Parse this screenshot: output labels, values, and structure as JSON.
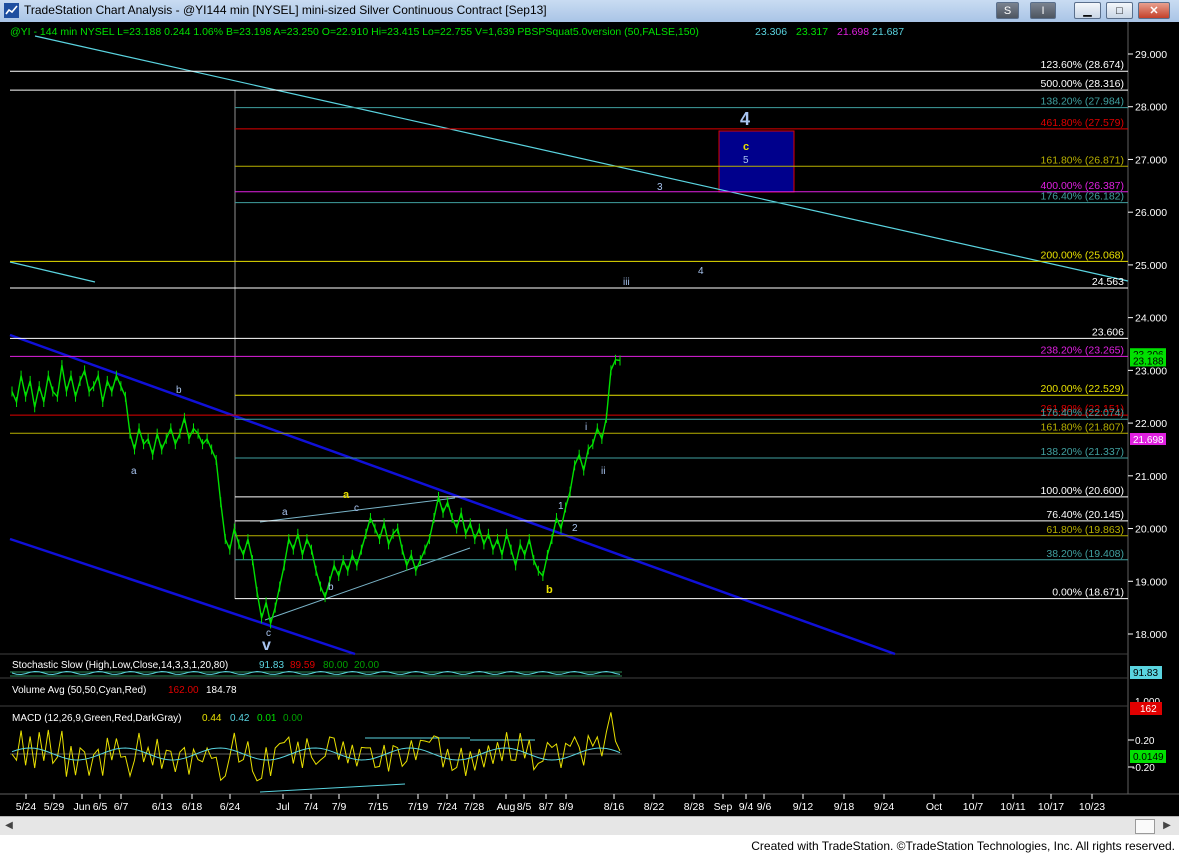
{
  "window": {
    "title": "TradeStation Chart Analysis - @YI144 min [NYSEL] mini-sized Silver Continuous Contract [Sep13]",
    "buttons": {
      "s": "S",
      "info": "I",
      "minimize": "▁",
      "maximize": "□",
      "close": "✕"
    }
  },
  "header": {
    "symbol_text": "@YI - 144 min  NYSEL  L=23.188  0.244  1.06%  B=23.198  A=23.250  O=22.910  Hi=23.415  Lo=22.755  V=1,639  PBSPSquat5.0version (50,FALSE,150)",
    "ind_values": [
      "23.306",
      "23.317",
      "21.698",
      "21.687"
    ]
  },
  "colors": {
    "green_price": "#00e000",
    "white": "#ffffff",
    "blue_channel": "#1010d8",
    "cyan_trend": "#5ad4e0",
    "red_fib": "#e00000",
    "magenta_fib": "#e020e0",
    "yellow_fib": "#e8e000",
    "olive_fib": "#b8b000",
    "teal_fib": "#40a0a0",
    "label_blue": "#a8c4f0",
    "box_fill": "#00008c"
  },
  "chart_data": {
    "type": "line",
    "title": "@YI 144 min mini-sized Silver Continuous Contract [Sep13]",
    "ylim": [
      17.5,
      29.4
    ],
    "price_axis_ticks": [
      "29.000",
      "28.000",
      "27.000",
      "26.000",
      "25.000",
      "24.000",
      "23.000",
      "22.000",
      "21.000",
      "20.000",
      "19.000",
      "18.000"
    ],
    "x_ticks": [
      "5/24",
      "5/29",
      "Jun",
      "6/5",
      "6/7",
      "6/13",
      "6/18",
      "6/24",
      "Jul",
      "7/4",
      "7/9",
      "7/15",
      "7/19",
      "7/24",
      "7/28",
      "Aug",
      "8/5",
      "8/7",
      "8/9",
      "8/16",
      "8/22",
      "8/28",
      "Sep",
      "9/4",
      "9/6",
      "9/12",
      "9/18",
      "9/24",
      "Oct",
      "10/7",
      "10/11",
      "10/17",
      "10/23"
    ],
    "series": [
      {
        "name": "price",
        "values": [
          22.6,
          22.4,
          22.9,
          22.5,
          22.8,
          22.3,
          22.7,
          22.4,
          22.9,
          22.6,
          22.5,
          23.1,
          22.6,
          22.9,
          22.5,
          22.8,
          23.0,
          22.6,
          22.7,
          22.9,
          22.4,
          22.8,
          22.6,
          22.9,
          22.7,
          22.5,
          21.8,
          21.5,
          21.9,
          21.6,
          21.7,
          21.4,
          21.8,
          21.5,
          21.7,
          21.9,
          21.6,
          21.8,
          22.1,
          21.7,
          21.9,
          21.8,
          21.6,
          21.7,
          21.5,
          21.3,
          20.5,
          19.8,
          19.6,
          20.0,
          19.7,
          19.5,
          19.8,
          19.4,
          18.8,
          18.3,
          18.6,
          18.2,
          18.5,
          18.9,
          19.3,
          19.8,
          19.6,
          19.9,
          19.5,
          19.8,
          19.6,
          19.2,
          18.9,
          18.7,
          19.0,
          19.3,
          19.1,
          19.4,
          19.2,
          19.5,
          19.3,
          19.6,
          19.9,
          20.2,
          20.0,
          19.8,
          20.1,
          19.7,
          19.9,
          20.0,
          19.6,
          19.3,
          19.5,
          19.2,
          19.4,
          19.6,
          19.8,
          20.2,
          20.6,
          20.3,
          20.5,
          20.2,
          20.0,
          20.3,
          19.9,
          20.1,
          19.8,
          20.0,
          19.7,
          19.9,
          19.6,
          19.8,
          19.5,
          19.9,
          19.6,
          19.3,
          19.7,
          19.5,
          19.8,
          19.4,
          19.2,
          19.1,
          19.5,
          19.8,
          20.2,
          20.0,
          20.4,
          20.7,
          21.2,
          21.4,
          21.1,
          21.5,
          21.6,
          21.9,
          21.7,
          22.1,
          23.0,
          23.2,
          23.188
        ]
      },
      {
        "name": "Stochastic Slow",
        "values": [
          91.83,
          89.59
        ]
      },
      {
        "name": "MACD",
        "values": [
          0.44,
          0.42,
          0.01
        ]
      }
    ],
    "fib_levels": [
      {
        "label": "123.60% (28.674)",
        "value": 28.674,
        "color": "white"
      },
      {
        "label": "500.00% (28.316)",
        "value": 28.316,
        "color": "white"
      },
      {
        "label": "138.20% (27.984)",
        "value": 27.984,
        "color": "teal_fib"
      },
      {
        "label": "461.80% (27.579)",
        "value": 27.579,
        "color": "red_fib"
      },
      {
        "label": "161.80% (26.871)",
        "value": 26.871,
        "color": "olive_fib"
      },
      {
        "label": "400.00% (26.387)",
        "value": 26.387,
        "color": "magenta_fib"
      },
      {
        "label": "176.40% (26.182)",
        "value": 26.182,
        "color": "teal_fib"
      },
      {
        "label": "200.00% (25.068)",
        "value": 25.068,
        "color": "yellow_fib"
      },
      {
        "label": "24.563",
        "value": 24.563,
        "color": "white"
      },
      {
        "label": "23.606",
        "value": 23.606,
        "color": "white"
      },
      {
        "label": "238.20% (23.265)",
        "value": 23.265,
        "color": "magenta_fib"
      },
      {
        "label": "200.00% (22.529)",
        "value": 22.529,
        "color": "yellow_fib"
      },
      {
        "label": "261.80% (22.151)",
        "value": 22.151,
        "color": "red_fib"
      },
      {
        "label": "176.40% (22.074)",
        "value": 22.074,
        "color": "teal_fib"
      },
      {
        "label": "161.80% (21.807)",
        "value": 21.807,
        "color": "olive_fib"
      },
      {
        "label": "138.20% (21.337)",
        "value": 21.337,
        "color": "teal_fib"
      },
      {
        "label": "100.00% (20.600)",
        "value": 20.6,
        "color": "white"
      },
      {
        "label": "76.40% (20.145)",
        "value": 20.145,
        "color": "white"
      },
      {
        "label": "61.80% (19.863)",
        "value": 19.863,
        "color": "olive_fib"
      },
      {
        "label": "38.20% (19.408)",
        "value": 19.408,
        "color": "teal_fib"
      },
      {
        "label": "0.00% (18.671)",
        "value": 18.671,
        "color": "white"
      }
    ],
    "price_flags": [
      {
        "text": "23.306",
        "value": 23.306,
        "color": "#00e000"
      },
      {
        "text": "23.188",
        "value": 23.188,
        "color": "#00e000"
      },
      {
        "text": "21.698",
        "value": 21.698,
        "color": "#e020e0"
      }
    ],
    "wave_labels": [
      {
        "text": "4",
        "kind": "big-blue"
      },
      {
        "text": "c",
        "kind": "yellow"
      },
      {
        "text": "5",
        "kind": "blue"
      },
      {
        "text": "3",
        "kind": "blue"
      },
      {
        "text": "4",
        "kind": "blue"
      },
      {
        "text": "iii",
        "kind": "blue"
      },
      {
        "text": "a",
        "kind": "blue"
      },
      {
        "text": "b",
        "kind": "blue"
      },
      {
        "text": "a",
        "kind": "yellow"
      },
      {
        "text": "c",
        "kind": "blue"
      },
      {
        "text": "a",
        "kind": "blue"
      },
      {
        "text": "b",
        "kind": "blue"
      },
      {
        "text": "c",
        "kind": "blue"
      },
      {
        "text": "v",
        "kind": "big-blue"
      },
      {
        "text": "1",
        "kind": "blue"
      },
      {
        "text": "2",
        "kind": "blue"
      },
      {
        "text": "i",
        "kind": "blue"
      },
      {
        "text": "ii",
        "kind": "blue"
      },
      {
        "text": "b",
        "kind": "yellow"
      }
    ]
  },
  "indicators": {
    "stochastic": {
      "label": "Stochastic Slow (High,Low,Close,14,3,3,1,20,80)",
      "values": [
        "91.83",
        "89.59",
        "80.00",
        "20.00"
      ],
      "axis_value": "91.83"
    },
    "volume": {
      "label": "Volume Avg (50,50,Cyan,Red)",
      "values": [
        "162.00",
        "184.78"
      ],
      "axis_value": "162",
      "axis_top": "1,000"
    },
    "macd": {
      "label": "MACD (12,26,9,Green,Red,DarkGray)",
      "values": [
        "0.44",
        "0.42",
        "0.01",
        "0.00"
      ],
      "axis_ticks": [
        "0.20",
        "0.0149",
        "-0.20"
      ]
    }
  },
  "footer": {
    "text": "Created with TradeStation. ©TradeStation Technologies, Inc. All rights reserved."
  }
}
